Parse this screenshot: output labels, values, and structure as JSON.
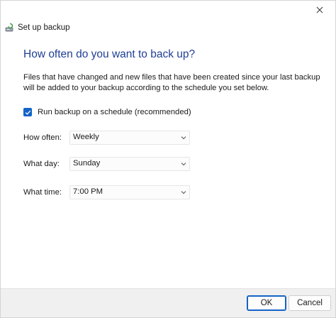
{
  "window": {
    "close_icon": "close-icon"
  },
  "nav": {
    "title": "Set up backup",
    "icon": "backup-icon"
  },
  "heading": "How often do you want to back up?",
  "description": "Files that have changed and new files that have been created since your last backup will be added to your backup according to the schedule you set below.",
  "schedule_checkbox": {
    "label": "Run backup on a schedule (recommended)",
    "checked": true
  },
  "fields": {
    "how_often": {
      "label": "How often:",
      "value": "Weekly"
    },
    "what_day": {
      "label": "What day:",
      "value": "Sunday"
    },
    "what_time": {
      "label": "What time:",
      "value": "7:00 PM"
    }
  },
  "buttons": {
    "ok": "OK",
    "cancel": "Cancel"
  },
  "colors": {
    "heading": "#1f3f94",
    "accent": "#1463c7"
  }
}
